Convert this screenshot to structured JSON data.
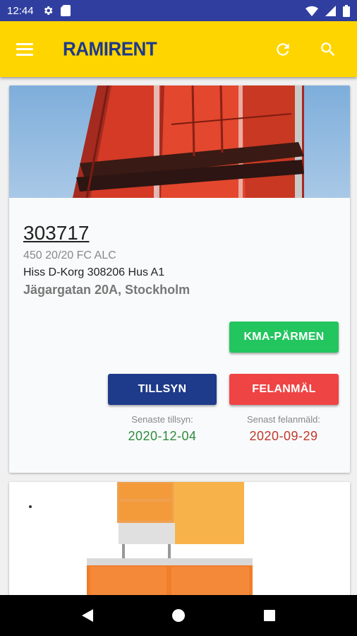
{
  "status_bar": {
    "time": "12:44"
  },
  "app_bar": {
    "brand": "RAMIRENT"
  },
  "unit": {
    "id": "303717",
    "model": "450 20/20 FC ALC",
    "description": "Hiss D-Korg 308206 Hus A1",
    "address": "Jägargatan 20A, Stockholm"
  },
  "actions": {
    "kma_label": "KMA-PÄRMEN",
    "tillsyn_label": "TILLSYN",
    "felanmal_label": "FELANMÄL"
  },
  "stats": {
    "tillsyn_label": "Senaste tillsyn:",
    "tillsyn_date": "2020-12-04",
    "fel_label": "Senast felanmäld:",
    "fel_date": "2020-09-29"
  },
  "colors": {
    "status_bar": "#303f9f",
    "app_bar": "#ffd500",
    "brand": "#1e3a8a",
    "kma_button": "#22c55e",
    "tillsyn_button": "#1e3a8a",
    "felanmal_button": "#ef4444",
    "tillsyn_date": "#2e8b3e",
    "fel_date": "#c0392b"
  },
  "icons": [
    "settings-icon",
    "sd-card-icon",
    "wifi-icon",
    "signal-icon",
    "battery-icon",
    "menu-icon",
    "refresh-icon",
    "search-icon",
    "back-icon",
    "home-icon",
    "recents-icon"
  ]
}
